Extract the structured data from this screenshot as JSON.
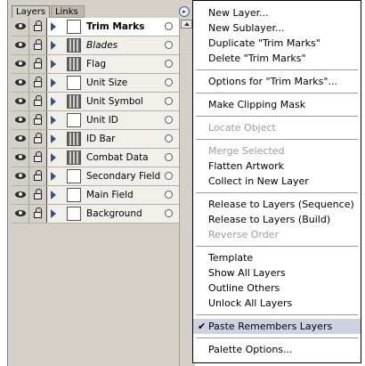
{
  "palette": {
    "tabs": {
      "active": "Layers",
      "inactive": "Links"
    },
    "menu_button_glyph": "▸",
    "layers": [
      {
        "name": "Trim Marks",
        "selected": true,
        "italic": false,
        "thumb": "blank"
      },
      {
        "name": "Blades",
        "selected": false,
        "italic": true,
        "thumb": "pattern"
      },
      {
        "name": "Flag",
        "selected": false,
        "italic": false,
        "thumb": "pattern"
      },
      {
        "name": "Unit Size",
        "selected": false,
        "italic": false,
        "thumb": "blank"
      },
      {
        "name": "Unit Symbol",
        "selected": false,
        "italic": false,
        "thumb": "pattern"
      },
      {
        "name": "Unit ID",
        "selected": false,
        "italic": false,
        "thumb": "blank"
      },
      {
        "name": "ID Bar",
        "selected": false,
        "italic": false,
        "thumb": "pattern"
      },
      {
        "name": "Combat Data",
        "selected": false,
        "italic": false,
        "thumb": "pattern"
      },
      {
        "name": "Secondary Field",
        "selected": false,
        "italic": false,
        "thumb": "blank"
      },
      {
        "name": "Main Field",
        "selected": false,
        "italic": false,
        "thumb": "blank"
      },
      {
        "name": "Background",
        "selected": false,
        "italic": false,
        "thumb": "blank"
      }
    ]
  },
  "menu": {
    "items": [
      {
        "label": "New Layer...",
        "disabled": false,
        "checked": false
      },
      {
        "label": "New Sublayer...",
        "disabled": false,
        "checked": false
      },
      {
        "label": "Duplicate \"Trim Marks\"",
        "disabled": false,
        "checked": false
      },
      {
        "label": "Delete \"Trim Marks\"",
        "disabled": false,
        "checked": false
      },
      {
        "separator": true
      },
      {
        "label": "Options for \"Trim Marks\"...",
        "disabled": false,
        "checked": false
      },
      {
        "separator": true
      },
      {
        "label": "Make Clipping Mask",
        "disabled": false,
        "checked": false
      },
      {
        "separator": true
      },
      {
        "label": "Locate Object",
        "disabled": true,
        "checked": false
      },
      {
        "separator": true
      },
      {
        "label": "Merge Selected",
        "disabled": true,
        "checked": false
      },
      {
        "label": "Flatten Artwork",
        "disabled": false,
        "checked": false
      },
      {
        "label": "Collect in New Layer",
        "disabled": false,
        "checked": false
      },
      {
        "separator": true
      },
      {
        "label": "Release to Layers (Sequence)",
        "disabled": false,
        "checked": false
      },
      {
        "label": "Release to Layers (Build)",
        "disabled": false,
        "checked": false
      },
      {
        "label": "Reverse Order",
        "disabled": true,
        "checked": false
      },
      {
        "separator": true
      },
      {
        "label": "Template",
        "disabled": false,
        "checked": false
      },
      {
        "label": "Show All Layers",
        "disabled": false,
        "checked": false
      },
      {
        "label": "Outline Others",
        "disabled": false,
        "checked": false
      },
      {
        "label": "Unlock All Layers",
        "disabled": false,
        "checked": false
      },
      {
        "separator": true
      },
      {
        "label": "Paste Remembers Layers",
        "disabled": false,
        "checked": true
      },
      {
        "separator": true
      },
      {
        "label": "Palette Options...",
        "disabled": false,
        "checked": false
      }
    ],
    "check_glyph": "✔"
  }
}
